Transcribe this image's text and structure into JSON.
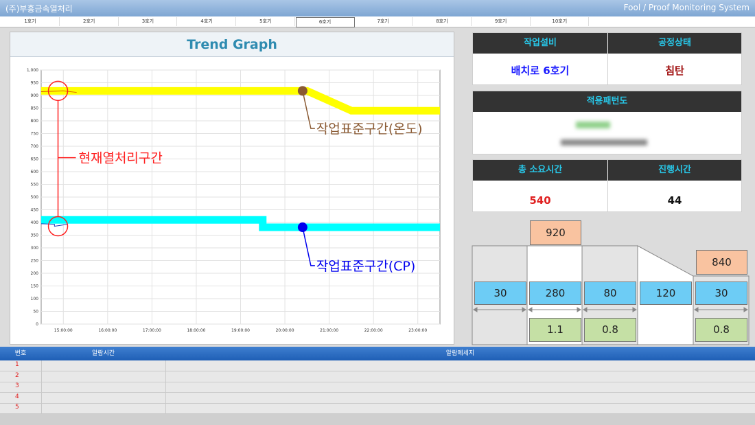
{
  "window": {
    "company": "(주)부흥금속열처리",
    "system": "Fool / Proof Monitoring System"
  },
  "tabs": [
    "1호기",
    "2호기",
    "3호기",
    "4호기",
    "5호기",
    "6호기",
    "7호기",
    "8호기",
    "9호기",
    "10호기"
  ],
  "active_tab_index": 5,
  "graph": {
    "title": "Trend Graph"
  },
  "chart_data": {
    "type": "line",
    "title": "Trend Graph",
    "x": [
      "15:00:00",
      "16:00:00",
      "17:00:00",
      "18:00:00",
      "19:00:00",
      "20:00:00",
      "21:00:00",
      "22:00:00",
      "23:00:00"
    ],
    "ylim": [
      0,
      1000
    ],
    "yticks": [
      "0",
      "50",
      "100",
      "150",
      "200",
      "250",
      "300",
      "350",
      "400",
      "450",
      "500",
      "550",
      "600",
      "650",
      "700",
      "750",
      "800",
      "850",
      "900",
      "950",
      "1,000"
    ],
    "grid": true,
    "series": [
      {
        "name": "작업표준구간(온도)",
        "color": "#ffff00",
        "points": [
          [
            14.5,
            918
          ],
          [
            20.5,
            918
          ],
          [
            21.5,
            840
          ],
          [
            23.5,
            840
          ]
        ]
      },
      {
        "name": "작업표준구간(CP)",
        "color": "#00ffff",
        "points": [
          [
            14.5,
            410
          ],
          [
            19.5,
            410
          ],
          [
            19.5,
            381
          ],
          [
            23.5,
            381
          ]
        ]
      }
    ],
    "annotations": [
      {
        "text": "현재열처리구간",
        "color": "#ff2020"
      },
      {
        "text": "작업표준구간(온도)",
        "color": "#8a5a33"
      },
      {
        "text": "작업표준구간(CP)",
        "color": "#0000ee"
      }
    ]
  },
  "status": {
    "equipment_label": "작업설비",
    "equipment_value": "배치로 6호기",
    "process_label": "공정상태",
    "process_value": "침탄",
    "pattern_label": "적용패턴도",
    "total_time_label": "총 소요시간",
    "total_time_value": "540",
    "elapsed_label": "진행시간",
    "elapsed_value": "44"
  },
  "diagram": {
    "temp_high": "920",
    "temp_low": "840",
    "times": [
      "30",
      "280",
      "80",
      "120",
      "30"
    ],
    "cp": [
      "1.1",
      "0.8",
      "0.8"
    ]
  },
  "alarm": {
    "columns": [
      "번호",
      "알람시간",
      "알람메세지"
    ],
    "rows": [
      "1",
      "2",
      "3",
      "4",
      "5"
    ]
  },
  "colors": {
    "accent": "#28c7e8",
    "header": "#333333",
    "equipment": "#1a1aff",
    "process": "#a01010",
    "total": "#e02020"
  }
}
